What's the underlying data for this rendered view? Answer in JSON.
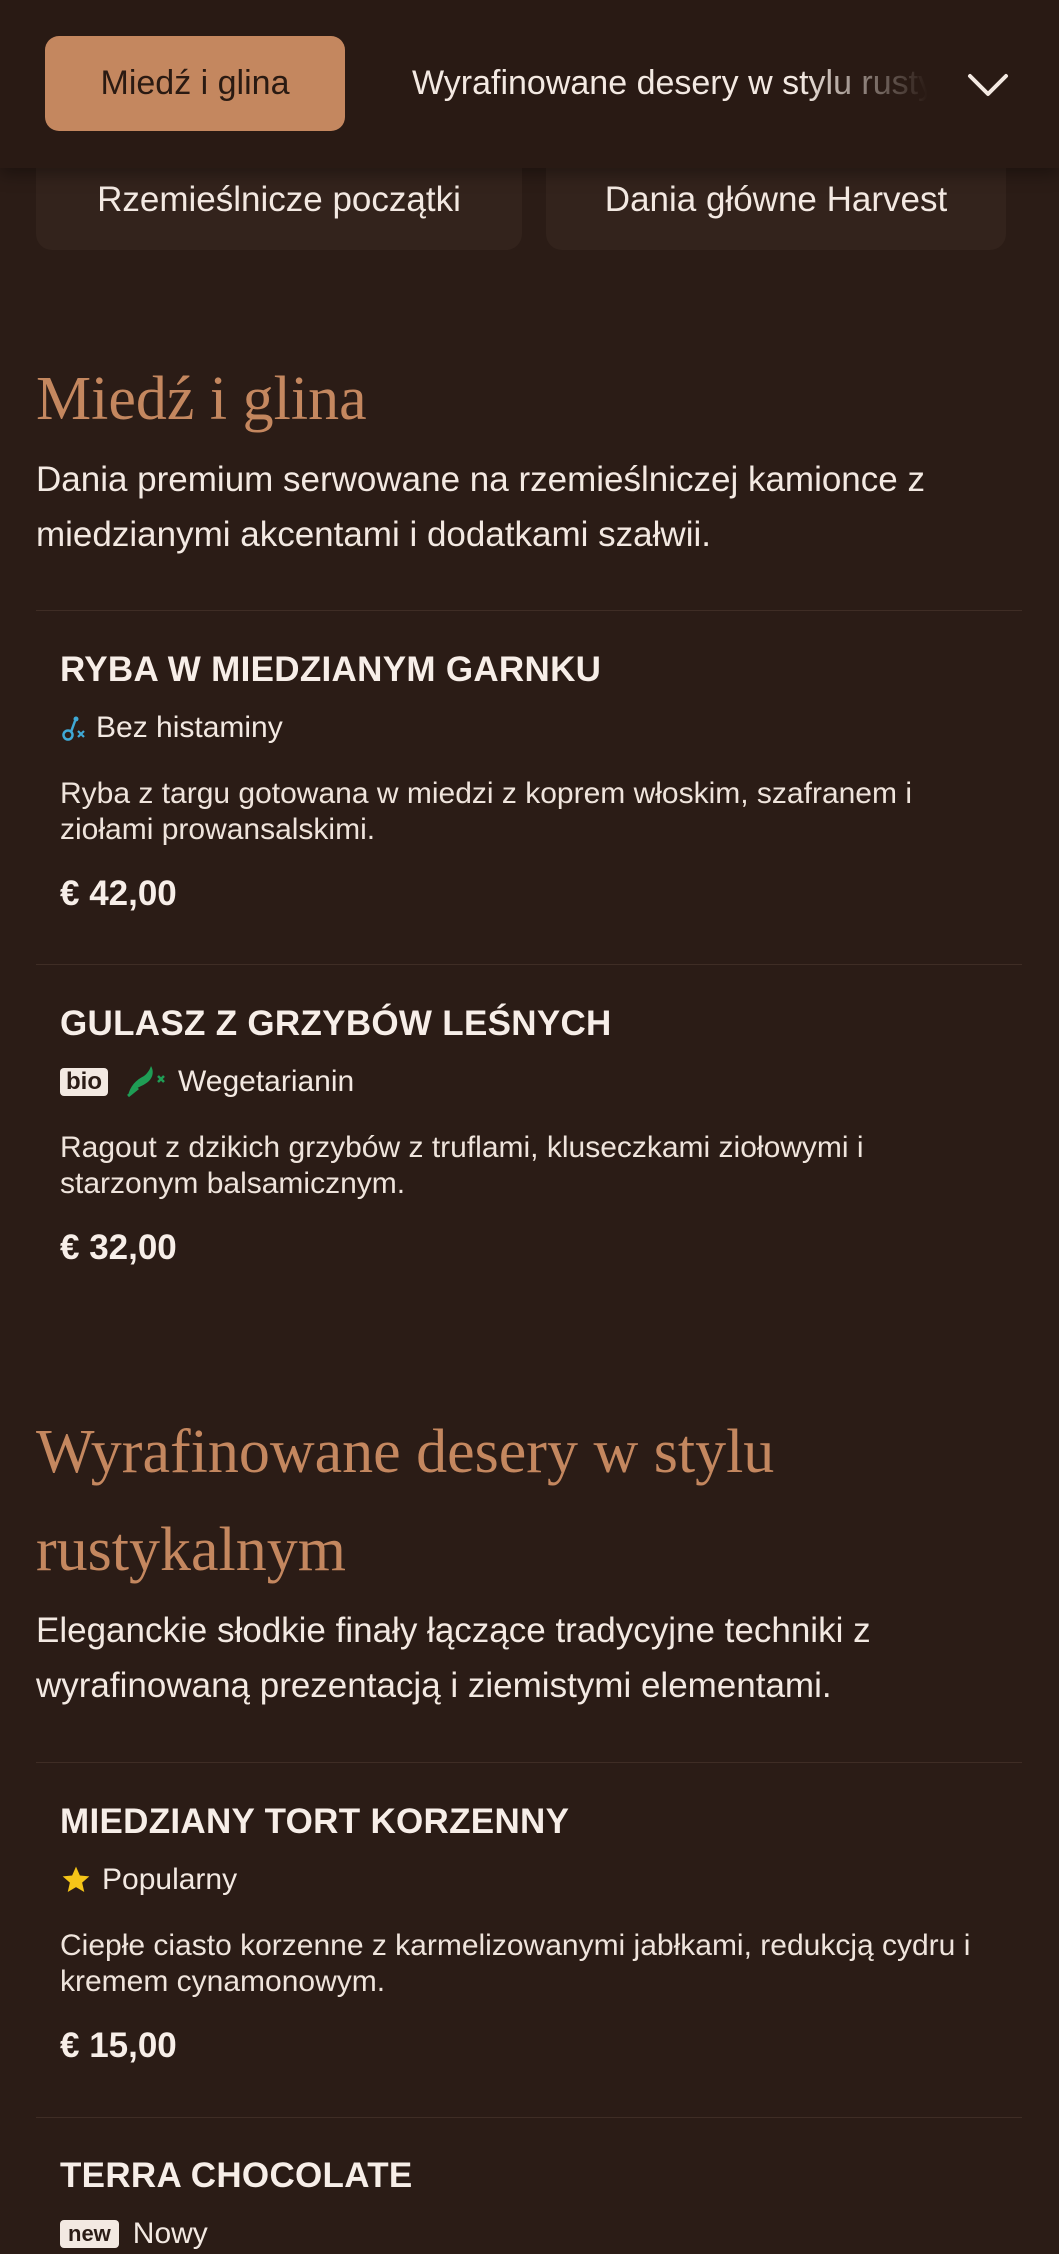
{
  "nav": {
    "active_chip": "Miedź i glina",
    "next_chip": "Wyrafinowane desery w stylu rustykalnym",
    "chevron_icon": "chevron-down-icon"
  },
  "categories": [
    {
      "label": "Rzemieślnicze początki"
    },
    {
      "label": "Dania główne Harvest"
    }
  ],
  "sections": [
    {
      "title": "Miedź i glina",
      "description": "Dania premium serwowane na rzemieślniczej kamionce z miedzianymi akcentami i dodatkami szałwii.",
      "items": [
        {
          "name": "RYBA W MIEDZIANYM GARNKU",
          "tag_label": "Bez histaminy",
          "tag_icon": "histamine-free-icon",
          "description": "Ryba z targu gotowana w miedzi z koprem włoskim, szafranem i ziołami prowansalskimi.",
          "price": "€ 42,00"
        },
        {
          "name": "GULASZ Z GRZYBÓW LEŚNYCH",
          "bio_badge": "bio",
          "tag_label": "Wegetarianin",
          "tag_icon": "vegetarian-icon",
          "description": "Ragout z dzikich grzybów z truflami, kluseczkami ziołowymi i starzonym balsamicznym.",
          "price": "€ 32,00"
        }
      ]
    },
    {
      "title": "Wyrafinowane desery w stylu rustykalnym",
      "description": "Eleganckie słodkie finały łączące tradycyjne techniki z wyrafinowaną prezentacją i ziemistymi elementami.",
      "items": [
        {
          "name": "MIEDZIANY TORT KORZENNY",
          "tag_label": "Popularny",
          "tag_icon": "star-icon",
          "description": "Ciepłe ciasto korzenne z karmelizowanymi jabłkami, redukcją cydru i kremem cynamonowym.",
          "price": "€ 15,00"
        },
        {
          "name": "TERRA CHOCOLATE",
          "new_badge": "new",
          "tag_label": "Nowy"
        }
      ]
    }
  ],
  "colors": {
    "background": "#2b1c16",
    "accent": "#c4875f",
    "text": "#f3e9e2",
    "star": "#f5c518",
    "vegetarian": "#1f9d55",
    "histamine": "#3fa9d6"
  }
}
